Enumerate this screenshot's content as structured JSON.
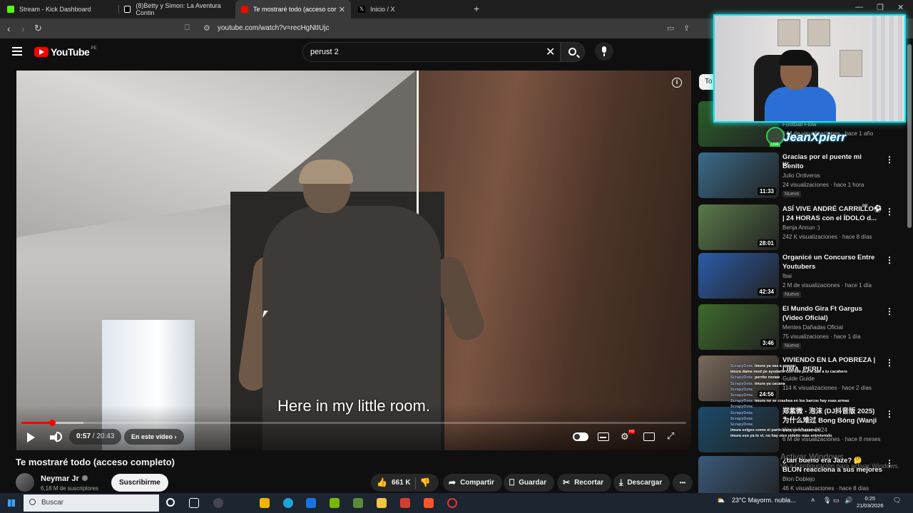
{
  "browser": {
    "tabs": [
      {
        "label": "Stream - Kick Dashboard",
        "color": "#53fc18"
      },
      {
        "label": "(8)Betty y Simon: La Aventura Contin",
        "color": "#ffffff"
      },
      {
        "label": "Te mostraré todo (acceso cor",
        "color": "#ff0000"
      },
      {
        "label": "Inicio / X",
        "color": "#ffffff"
      }
    ],
    "url": "youtube.com/watch?v=recHgNtIUjc"
  },
  "youtube": {
    "logo_text": "YouTube",
    "country": "PE",
    "search_value": "perust 2",
    "search_clear": "✕"
  },
  "player": {
    "subtitle": "Here in my little room.",
    "time_current": "0:57",
    "time_total": "/ 20:43",
    "chapter_label": "En este vídeo",
    "progress_fraction": 0.046,
    "buffer_fraction": 0.093,
    "accent": "#ff0000"
  },
  "video": {
    "title": "Te mostraré todo (acceso completo)",
    "channel": "Neymar Jr",
    "subscribers": "6,18 M de suscriptores",
    "subscribe_label": "Suscribirme",
    "likes": "661 K",
    "share_label": "Compartir",
    "save_label": "Guardar",
    "clip_label": "Recortar",
    "download_label": "Descargar",
    "more_label": "•••"
  },
  "sidebar": {
    "chip_partial": "To",
    "recommendations": [
      {
        "title": "",
        "channel": "Football Flow",
        "meta": "1 M de visualizaciones · hace 1 año",
        "duration": "",
        "badge": "",
        "thumb": "#2a5e2a"
      },
      {
        "title": "Gracias por el puente mi Benito",
        "channel": "Julio Ontiveros",
        "meta": "24 visualizaciones · hace 1 hora",
        "duration": "11:33",
        "badge": "Nuevo",
        "thumb": "#3b6b8a",
        "flag": "MX"
      },
      {
        "title": "ASÍ VIVE ANDRÉ CARRILLO⚽ | 24 HORAS con el ÍDOLO d...",
        "channel": "Benja Annun :)",
        "meta": "242 K visualizaciones · hace 8 días",
        "duration": "28:01",
        "badge": "",
        "thumb": "#5a7a4a",
        "flag": "PE"
      },
      {
        "title": "Organicé un Concurso Entre Youtubers",
        "channel": "Ibai",
        "meta": "2 M de visualizaciones · hace 1 día",
        "duration": "42:34",
        "badge": "Nuevo",
        "thumb": "#2b5ca8"
      },
      {
        "title": "El Mundo Gira Ft Gargus (Video Oficial)",
        "channel": "Mentes Dañadas Oficial",
        "meta": "75 visualizaciones · hace 1 día",
        "duration": "3:46",
        "badge": "Nuevo",
        "thumb": "#3e6a2c"
      },
      {
        "title": "VIVIENDO EN LA POBREZA | LIMA, PERU",
        "channel": "Guide Guide",
        "meta": "114 K visualizaciones · hace 2 días",
        "duration": "24:56",
        "badge": "",
        "thumb": "#7a6a5a"
      },
      {
        "title": "郑紫微 - 泡沫 (DJ抖音版 2025) 为什么难过 Bong Bóng (Wanji ...",
        "channel": "Wanji Music 2024",
        "meta": "6 M de visualizaciones · hace 8 meses",
        "duration": "",
        "badge": "",
        "thumb": "#1a4a6a"
      },
      {
        "title": "¿tan bueno era Jaze? 🤔 BLON reacciona a sus mejores ...",
        "channel": "Blon Doblejo",
        "meta": "46 K visualizaciones · hace 8 días",
        "duration": "",
        "badge": "",
        "thumb": "#3a5a7a"
      }
    ]
  },
  "stream_overlay": {
    "name": "JeanXpierr",
    "live_label": "LIVE",
    "chat": [
      {
        "user": "ScrapyDota:",
        "msg": "imura ya vas a apagar"
      },
      {
        "user": "",
        "msg": "imura dame mod pe ayudarte con eso pes le das a tu cacahero"
      },
      {
        "user": "ScrapyDota:",
        "msg": "perrito noraw"
      },
      {
        "user": "ScrapyDota:",
        "msg": "imura ya cacana"
      },
      {
        "user": "ScrapyDota:",
        "msg": ""
      },
      {
        "user": "ScrapyDota:",
        "msg": ""
      },
      {
        "user": "ScrapyDota:",
        "msg": "imura no se crashea en los barcos hay esas armas"
      },
      {
        "user": "ScrapyDota:",
        "msg": ""
      },
      {
        "user": "ScrapyDota:",
        "msg": ""
      },
      {
        "user": "ScrapyDota:",
        "msg": ""
      },
      {
        "user": "ScrapyDota:",
        "msg": ""
      },
      {
        "user": "",
        "msg": "imura exiges como el participara conchasumare"
      },
      {
        "user": "",
        "msg": "imura eso ya lo vi, no hay otro videito más entretenido"
      }
    ],
    "watermark_title": "Activar Windows",
    "watermark_sub": "Ve a Configuración para activar Windows."
  },
  "taskbar": {
    "search_placeholder": "Buscar",
    "weather": "23°C  Mayorm. nubla...",
    "time": "0:25",
    "date": "21/03/2026"
  }
}
